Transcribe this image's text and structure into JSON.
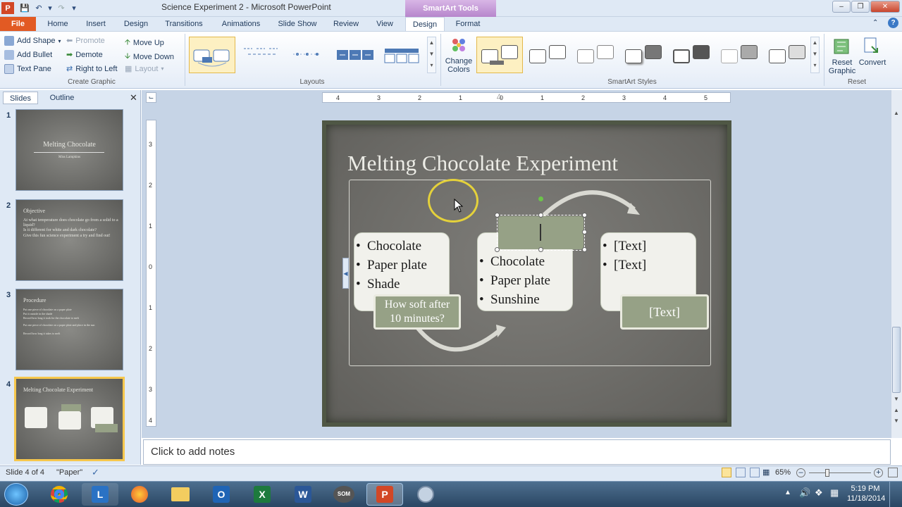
{
  "window": {
    "title": "Science Experiment 2  -  Microsoft PowerPoint",
    "context_tab_group": "SmartArt Tools"
  },
  "tabs": [
    "File",
    "Home",
    "Insert",
    "Design",
    "Transitions",
    "Animations",
    "Slide Show",
    "Review",
    "View",
    "Design",
    "Format"
  ],
  "ribbon": {
    "create_graphic": {
      "add_shape": "Add Shape",
      "add_bullet": "Add Bullet",
      "text_pane": "Text Pane",
      "promote": "Promote",
      "demote": "Demote",
      "right_to_left": "Right to Left",
      "move_up": "Move Up",
      "move_down": "Move Down",
      "layout": "Layout",
      "label": "Create Graphic"
    },
    "layouts_label": "Layouts",
    "change_colors": [
      "Change",
      "Colors"
    ],
    "styles_label": "SmartArt Styles",
    "reset": {
      "reset_graphic": [
        "Reset",
        "Graphic"
      ],
      "convert": "Convert",
      "label": "Reset"
    }
  },
  "left_pane": {
    "tabs": [
      "Slides",
      "Outline"
    ],
    "slides": [
      {
        "number": "1",
        "title": "Melting Chocolate",
        "subtitle": "Miss Lampkins"
      },
      {
        "number": "2",
        "title": "Objective",
        "lines": [
          "At what temperature does chocolate go from a solid to a liquid?",
          "Is it different for white and dark chocolate?",
          "Give this fun science experiment a try and find out!"
        ]
      },
      {
        "number": "3",
        "title": "Procedure",
        "lines": [
          "Put one piece of chocolate on a paper plate",
          "Put it outside in the shade",
          "Record how long it took for the chocolate to melt",
          "Put one piece of chocolate on a paper plate and place in the sun",
          "Record how long it takes to melt"
        ]
      },
      {
        "number": "4",
        "title": "Melting Chocolate Experiment"
      }
    ]
  },
  "slide": {
    "title": "Melting Chocolate Experiment",
    "col1": {
      "bullets": [
        "Chocolate",
        "Paper plate",
        "Shade"
      ],
      "tag": [
        "How soft after",
        "10 minutes?"
      ]
    },
    "col2": {
      "bullets": [
        "Chocolate",
        "Paper plate",
        "Sunshine"
      ],
      "tag": ""
    },
    "col3": {
      "bullets": [
        "[Text]",
        "[Text]"
      ],
      "tag": "[Text]"
    }
  },
  "ruler": {
    "h": [
      "4",
      "3",
      "2",
      "1",
      "0",
      "1",
      "2",
      "3",
      "4",
      "5"
    ],
    "v": [
      "3",
      "2",
      "1",
      "0",
      "1",
      "2",
      "3",
      "4"
    ]
  },
  "notes": {
    "placeholder": "Click to add notes"
  },
  "status": {
    "slide_info": "Slide 4 of 4",
    "theme": "\"Paper\"",
    "zoom": "65%"
  },
  "taskbar": {
    "time": "5:19 PM",
    "date": "11/18/2014"
  }
}
